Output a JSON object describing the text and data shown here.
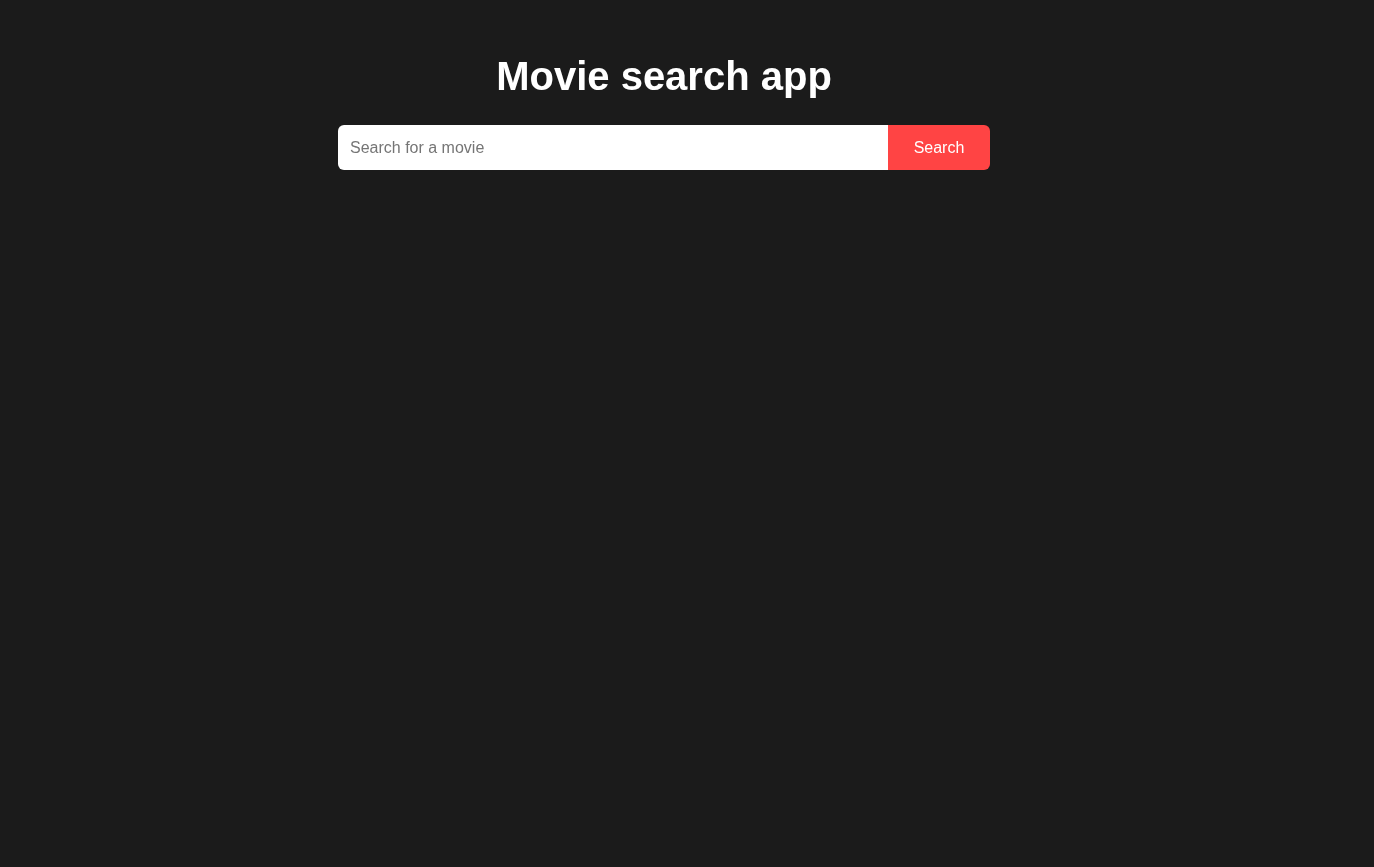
{
  "header": {
    "title": "Movie search app"
  },
  "search": {
    "placeholder": "Search for a movie",
    "button": "Search"
  }
}
